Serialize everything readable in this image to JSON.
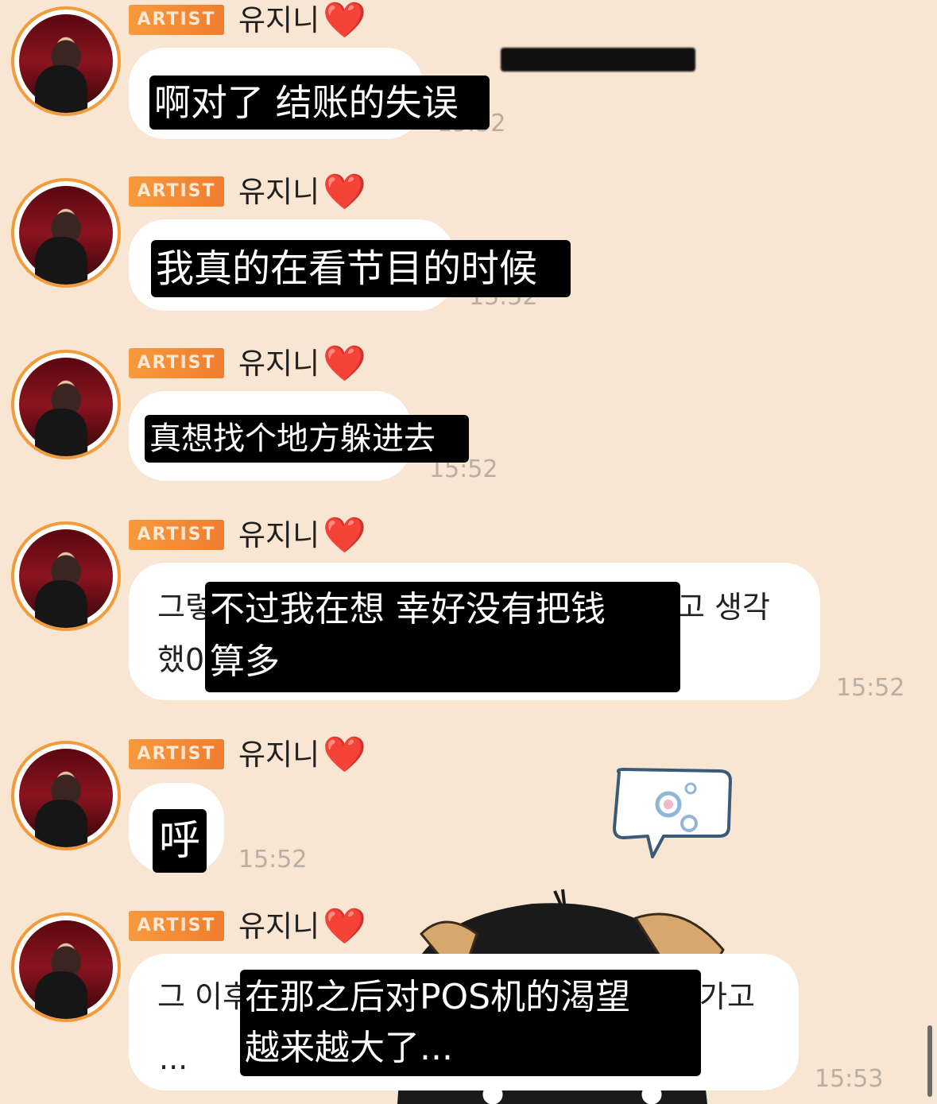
{
  "chat": {
    "messages": [
      {
        "badge": "ARTIST",
        "sender": "유지니",
        "heart": "❤️",
        "overlay_text": "啊对了 结账的失误",
        "time": "15:52",
        "time_partial": "15:52"
      },
      {
        "badge": "ARTIST",
        "sender": "유지니",
        "heart": "❤️",
        "overlay_text": "我真的在看节目的时候",
        "time": "15:52"
      },
      {
        "badge": "ARTIST",
        "sender": "유지니",
        "heart": "❤️",
        "overlay_text": "真想找个地方躲进去",
        "time": "15:52"
      },
      {
        "badge": "ARTIST",
        "sender": "유지니",
        "heart": "❤️",
        "orig_line1_left": "그렇",
        "orig_line1_right": "고 생각",
        "orig_line2_left": "했0",
        "overlay_line1": "不过我在想 幸好没有把钱",
        "overlay_line2": "算多",
        "time": "15:52"
      },
      {
        "badge": "ARTIST",
        "sender": "유지니",
        "heart": "❤️",
        "overlay_text": "呼",
        "time": "15:52"
      },
      {
        "badge": "ARTIST",
        "sender": "유지니",
        "heart": "❤️",
        "orig_line1_left": "그 이후",
        "orig_line1_right": "가고",
        "orig_line2_left": "...",
        "overlay_line1": "在那之后对POS机的渴望",
        "overlay_line2": "越来越大了...",
        "time": "15:53"
      }
    ]
  },
  "colors": {
    "background": "#f9e6d2",
    "badge": "#f39a3b",
    "heart": "#e3232e",
    "bubble": "#ffffff",
    "overlay": "#000000",
    "timestamp": "#b8aea4"
  }
}
